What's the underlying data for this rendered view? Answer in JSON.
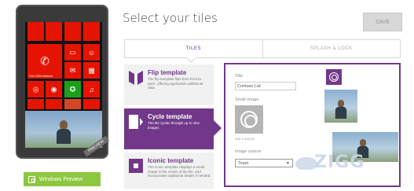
{
  "header": {
    "title": "Select your tiles",
    "save_label": "SAVE"
  },
  "tabs": [
    {
      "label": "TILES",
      "active": true
    },
    {
      "label": "SPLASH & LOCK",
      "active": false
    }
  ],
  "templates": [
    {
      "title": "Flip template",
      "description": "The flip template flips from front to back, offering application additional data."
    },
    {
      "title": "Cycle template",
      "description": "The tile cycles through up to nine images"
    },
    {
      "title": "Iconic template",
      "description": "The iconic template displays a small image in the center of the tile, and incorporates additional details if needed"
    }
  ],
  "panel": {
    "title_label": "Title",
    "title_value": "Contoso Ltd",
    "small_image_label": "Small image",
    "small_image_size": "110 x 110 px",
    "image_source_label": "Image source",
    "image_source_value": "Team"
  },
  "phone": {
    "tile_caption": "Free GSM Network",
    "preview_ribbon": "PREVIEW"
  },
  "windows_preview_label": "Windows Preview",
  "watermark": "ZIGG",
  "colors": {
    "accent": "#71388a",
    "tile_red": "#e51400",
    "wp_green": "#8dc63f"
  }
}
